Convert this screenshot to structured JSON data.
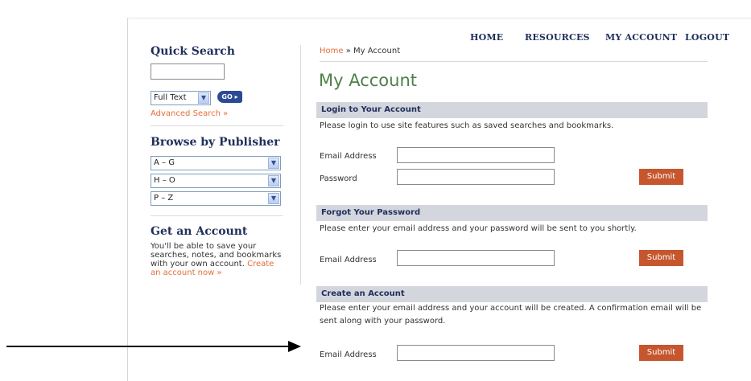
{
  "nav": {
    "home": "HOME",
    "resources": "RESOURCES",
    "my_account": "MY ACCOUNT",
    "logout": "LOGOUT"
  },
  "sidebar": {
    "quick_search_title": "Quick Search",
    "search_value": "",
    "search_type": "Full Text",
    "go_label": "GO",
    "advanced_search": "Advanced Search »",
    "browse_title": "Browse by Publisher",
    "publisher_ranges": [
      "A – G",
      "H – O",
      "P – Z"
    ],
    "get_account_title": "Get an Account",
    "get_account_text": "You'll be able to save your searches, notes, and bookmarks with your own account.",
    "create_link": "Create an account now »"
  },
  "breadcrumb": {
    "home": "Home",
    "sep": " » ",
    "current": "My Account"
  },
  "page_title": "My Account",
  "login": {
    "heading": "Login to Your Account",
    "desc": "Please login to use site features such as saved searches and bookmarks.",
    "email_label": "Email Address",
    "password_label": "Password",
    "submit": "Submit"
  },
  "forgot": {
    "heading": "Forgot Your Password",
    "desc": "Please enter your email address and your password will be sent to you shortly.",
    "email_label": "Email Address",
    "submit": "Submit"
  },
  "create": {
    "heading": "Create an Account",
    "desc": "Please enter your email address and your account will be created. A confirmation email will be sent along with your password.",
    "email_label": "Email Address",
    "submit": "Submit"
  },
  "colors": {
    "navy": "#1f2f5a",
    "green_title": "#4f7f4a",
    "orange_link": "#e46e3c",
    "submit_bg": "#c6562e",
    "section_bar": "#d4d6dd"
  },
  "annotation": {
    "icon": "right-arrow-icon"
  }
}
